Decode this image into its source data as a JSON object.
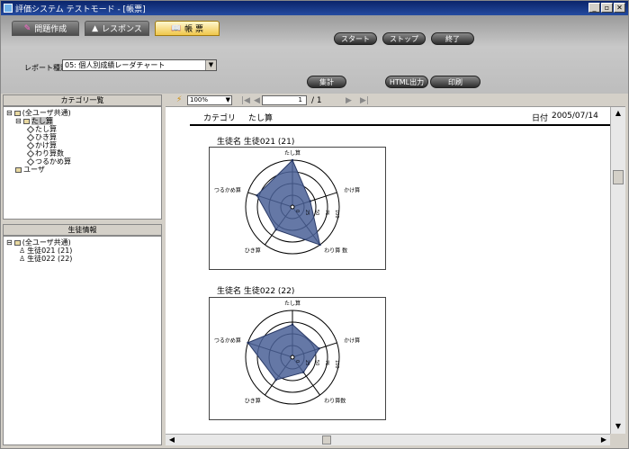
{
  "window": {
    "title": "評価システム テストモード - [帳票]",
    "controls": [
      "_",
      "▫",
      "✕"
    ]
  },
  "toolbar": {
    "tabs": [
      {
        "label": "問題作成"
      },
      {
        "label": "レスポンス"
      },
      {
        "label": "帳 票"
      }
    ],
    "buttons": {
      "start": "スタート",
      "stop": "ストップ",
      "end": "終了",
      "aggregate": "集計",
      "html": "HTML出力",
      "print": "印刷"
    },
    "report_label": "レポート種別",
    "report_value": "05: 個人別成績レーダチャート"
  },
  "category_panel": {
    "header": "カテゴリ一覧",
    "tree": [
      "(全ユーザ共通)",
      "たし算",
      "たし算",
      "ひき算",
      "かけ算",
      "わり算数",
      "つるかめ算",
      "ユーザ"
    ]
  },
  "student_panel": {
    "header": "生徒情報",
    "tree": [
      "(全ユーザ共通)",
      "生徒021 (21)",
      "生徒022 (22)"
    ]
  },
  "viewer": {
    "zoom": "100%",
    "page": "1",
    "page_total": "/ 1"
  },
  "report": {
    "category_label": "カテゴリ",
    "category_value": "たし算",
    "date_label": "日付",
    "date_value": "2005/07/14",
    "students": [
      {
        "heading": "生徒名 生徒021 (21)"
      },
      {
        "heading": "生徒名 生徒022 (22)"
      }
    ]
  },
  "chart_data": [
    {
      "type": "radar",
      "title": "生徒名 生徒021 (21)",
      "categories": [
        "たし算",
        "かけ算",
        "わり算 数",
        "ひき算",
        "つるかめ算"
      ],
      "values": [
        100,
        40,
        100,
        60,
        80
      ],
      "ticks": [
        "0",
        "25",
        "50",
        "75",
        "100"
      ],
      "color": "#4a6096"
    },
    {
      "type": "radar",
      "title": "生徒名 生徒022 (22)",
      "categories": [
        "たし算",
        "かけ算",
        "わり算数",
        "ひき算",
        "つるかめ算"
      ],
      "values": [
        70,
        60,
        40,
        60,
        100
      ],
      "ticks": [
        "0",
        "25",
        "50",
        "75",
        "100"
      ],
      "color": "#4a6096"
    }
  ]
}
